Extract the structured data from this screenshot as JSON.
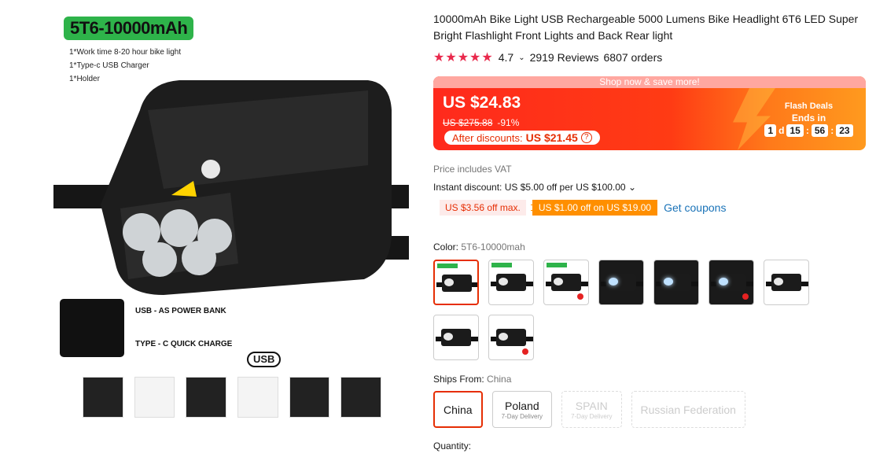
{
  "gallery": {
    "badge": "5T6-10000mAh",
    "specs": [
      "1*Work time 8-20 hour bike light",
      "1*Type-c USB Charger",
      "1*Holder"
    ],
    "port_labels": [
      "USB - AS POWER BANK",
      "TYPE - C QUICK CHARGE"
    ],
    "usb_tag": "USB"
  },
  "product": {
    "title": "10000mAh Bike Light USB Rechargeable 5000 Lumens Bike Headlight 6T6 LED Super Bright Flashlight Front Lights and Back Rear light",
    "stars": "★★★★★",
    "rating": "4.7",
    "reviews": "2919 Reviews",
    "orders": "6807 orders"
  },
  "price": {
    "banner": "Shop now & save more!",
    "current": "US $24.83",
    "original": "US $275.88",
    "discount_pct": "-91%",
    "after_label": "After discounts:",
    "after_value": "US $21.45",
    "help": "?",
    "flash_title": "Flash Deals",
    "ends_in": "Ends in",
    "timer": {
      "days": "1",
      "d": "d",
      "hours": "15",
      "minutes": "56",
      "seconds": "23",
      "sep": ":"
    }
  },
  "vat": "Price includes VAT",
  "instant": "Instant discount: US $5.00 off per US $100.00 ⌄",
  "coupons": {
    "c1": "US $3.56 off max.",
    "c2": "US $1.00 off on US $19.00",
    "get": "Get coupons"
  },
  "color": {
    "label": "Color:",
    "value": "5T6-10000mah"
  },
  "ships": {
    "label": "Ships From:",
    "value": "China",
    "options": [
      {
        "name": "China",
        "sub": ""
      },
      {
        "name": "Poland",
        "sub": "7-Day Delivery"
      },
      {
        "name": "SPAIN",
        "sub": "7-Day Delivery"
      },
      {
        "name": "Russian Federation",
        "sub": ""
      }
    ]
  },
  "quantity_label": "Quantity:"
}
